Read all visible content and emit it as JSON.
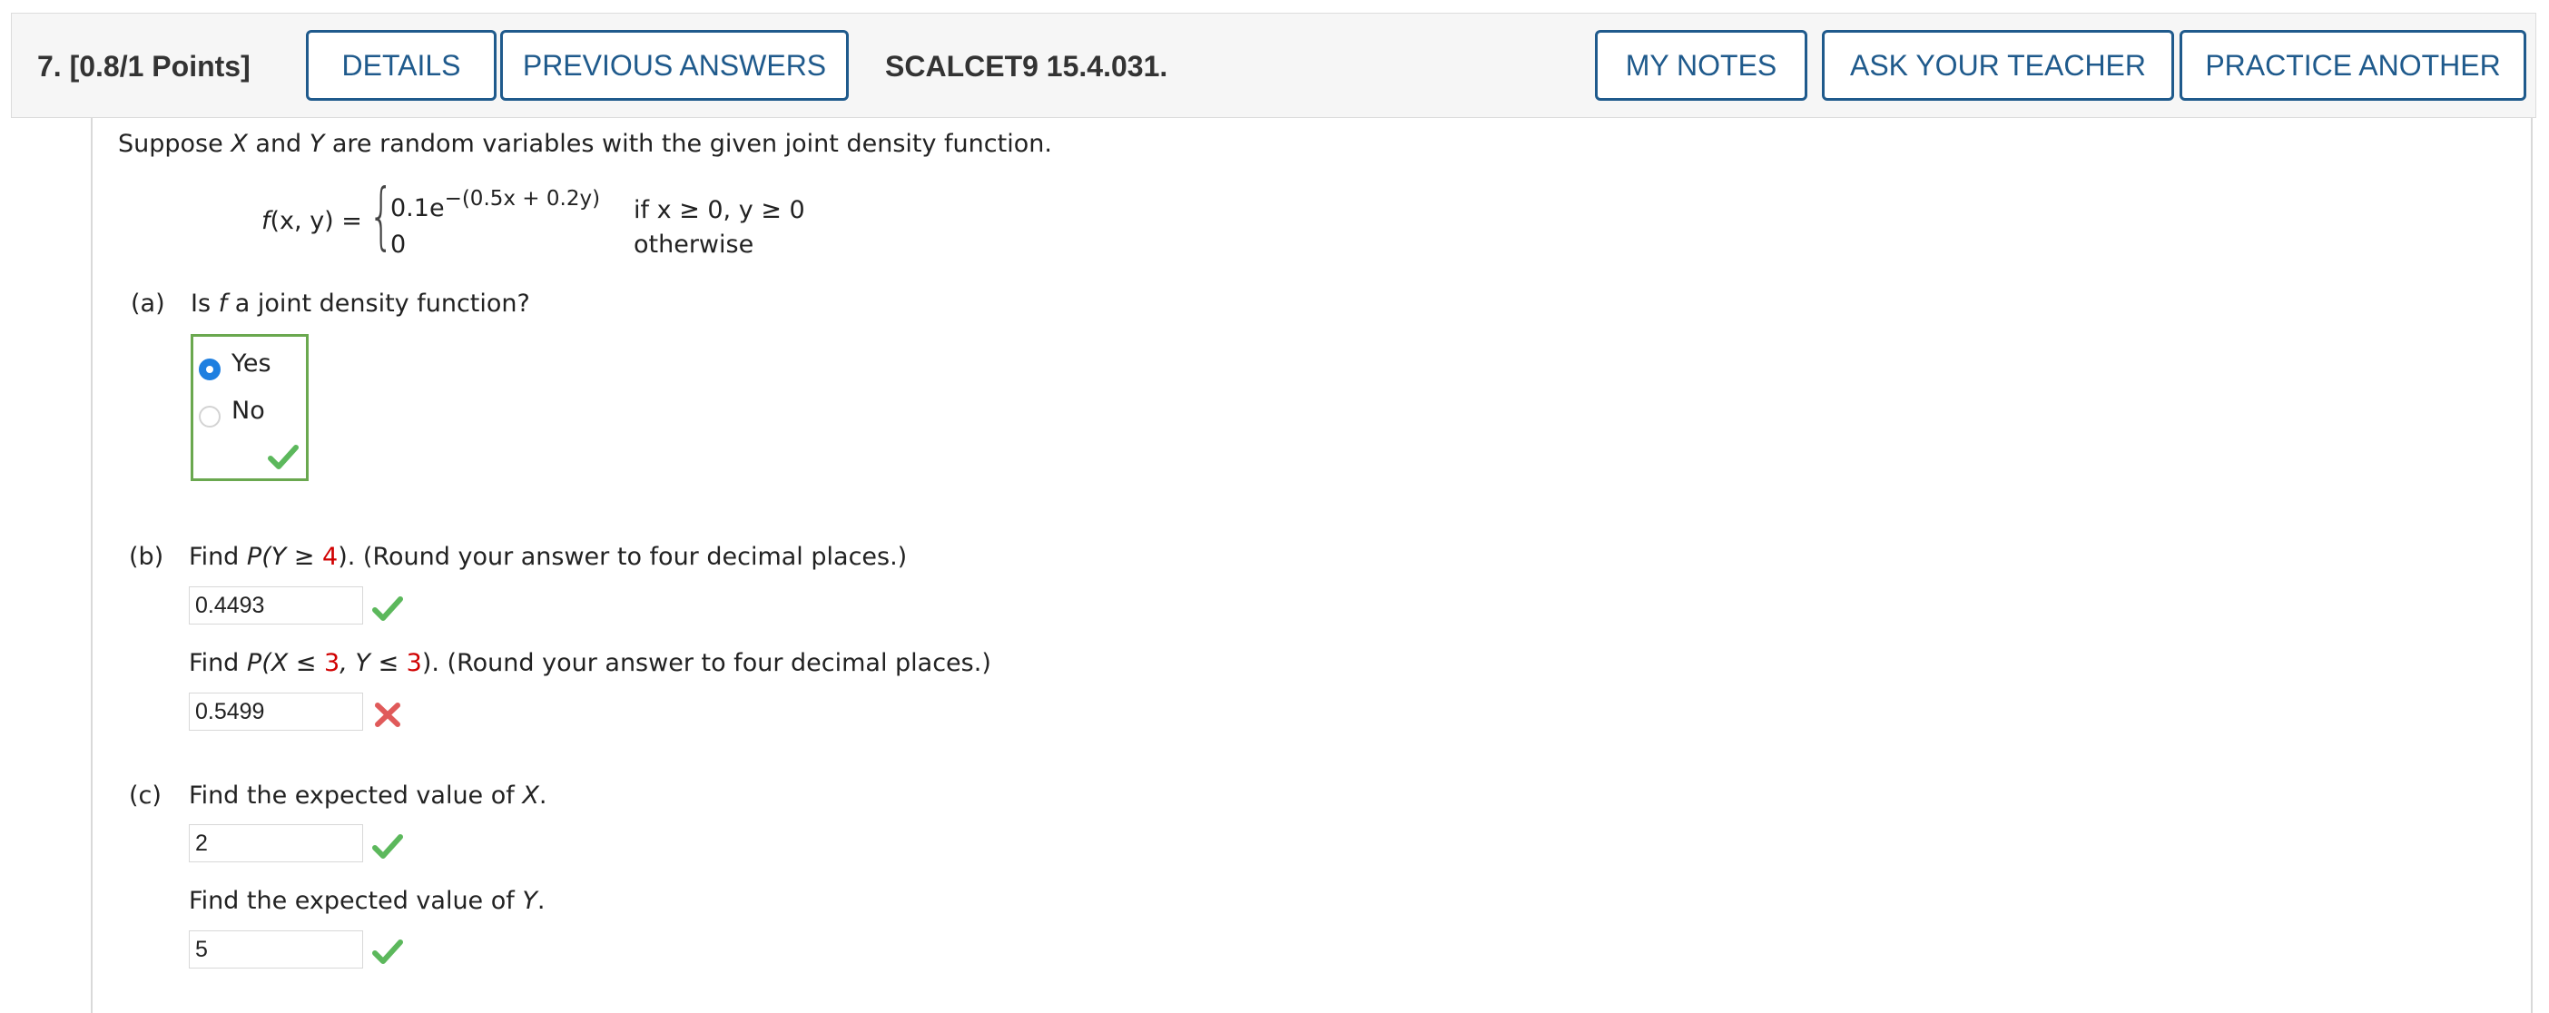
{
  "header": {
    "question_number": "7. [0.8/1 Points]",
    "details_label": "DETAILS",
    "previous_answers_label": "PREVIOUS ANSWERS",
    "problem_code": "SCALCET9 15.4.031.",
    "my_notes_label": "MY NOTES",
    "ask_teacher_label": "ASK YOUR TEACHER",
    "practice_another_label": "PRACTICE ANOTHER"
  },
  "problem": {
    "intro_pre": "Suppose ",
    "intro_x": "X",
    "intro_mid": " and ",
    "intro_y": "Y",
    "intro_post": " are random variables with the given joint density function.",
    "fx_lhs_f": "f",
    "fx_lhs_rest": "(x, y) =",
    "case1_expr": "0.1e",
    "case1_exponent": "−(0.5x + 0.2y)",
    "case1_cond": "if x ≥ 0, y ≥ 0",
    "case2_expr": "0",
    "case2_cond": "otherwise"
  },
  "part_a": {
    "label": "(a)",
    "q_pre": "Is ",
    "q_f": "f",
    "q_post": " a joint density function?",
    "options": [
      "Yes",
      "No"
    ],
    "selected": "Yes",
    "status": "correct"
  },
  "part_b": {
    "label": "(b)",
    "q1_pre": "Find ",
    "q1_expr": "P(Y ≥ ",
    "q1_num": "4",
    "q1_close": ")",
    "q1_post": ". (Round your answer to four decimal places.)",
    "answer1": "0.4493",
    "status1": "correct",
    "q2_pre": "Find ",
    "q2_expr1": "P(X ≤ ",
    "q2_num1": "3",
    "q2_expr2": ", Y ≤ ",
    "q2_num2": "3",
    "q2_close": ")",
    "q2_post": ". (Round your answer to four decimal places.)",
    "answer2": "0.5499",
    "status2": "incorrect"
  },
  "part_c": {
    "label": "(c)",
    "q1_pre": "Find the expected value of ",
    "q1_var": "X",
    "q1_post": ".",
    "answer1": "2",
    "status1": "correct",
    "q2_pre": "Find the expected value of ",
    "q2_var": "Y",
    "q2_post": ".",
    "answer2": "5",
    "status2": "correct"
  },
  "colors": {
    "button_border": "#1f5a8c",
    "correct": "#5cb85c",
    "incorrect": "#e05a5a",
    "highlight_number": "#d00000",
    "radio_selected": "#1e7fe0"
  }
}
